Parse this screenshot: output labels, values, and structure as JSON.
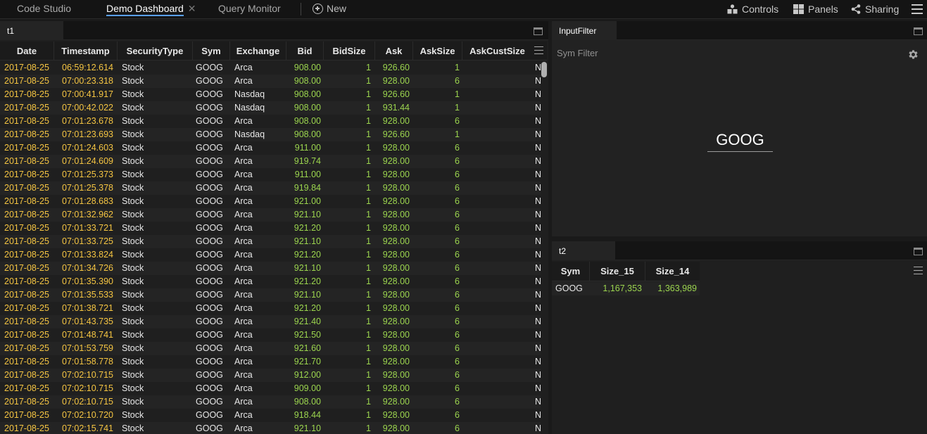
{
  "nav": {
    "tabs": [
      {
        "label": "Code Studio"
      },
      {
        "label": "Demo Dashboard",
        "active": true
      },
      {
        "label": "Query Monitor"
      }
    ],
    "new_label": "New",
    "right": {
      "controls": "Controls",
      "panels": "Panels",
      "sharing": "Sharing"
    }
  },
  "colors": {
    "date": "#f5c542",
    "number": "#9bd44e",
    "accent": "#5aa0ff"
  },
  "t1": {
    "title": "t1",
    "columns": [
      "Date",
      "Timestamp",
      "SecurityType",
      "Sym",
      "Exchange",
      "Bid",
      "BidSize",
      "Ask",
      "AskSize",
      "AskCustSize"
    ],
    "rows": [
      [
        "2017-08-25",
        "06:59:12.614",
        "Stock",
        "GOOG",
        "Arca",
        "908.00",
        "1",
        "926.60",
        "1",
        "N"
      ],
      [
        "2017-08-25",
        "07:00:23.318",
        "Stock",
        "GOOG",
        "Arca",
        "908.00",
        "1",
        "928.00",
        "6",
        "N"
      ],
      [
        "2017-08-25",
        "07:00:41.917",
        "Stock",
        "GOOG",
        "Nasdaq",
        "908.00",
        "1",
        "926.60",
        "1",
        "N"
      ],
      [
        "2017-08-25",
        "07:00:42.022",
        "Stock",
        "GOOG",
        "Nasdaq",
        "908.00",
        "1",
        "931.44",
        "1",
        "N"
      ],
      [
        "2017-08-25",
        "07:01:23.678",
        "Stock",
        "GOOG",
        "Arca",
        "908.00",
        "1",
        "928.00",
        "6",
        "N"
      ],
      [
        "2017-08-25",
        "07:01:23.693",
        "Stock",
        "GOOG",
        "Nasdaq",
        "908.00",
        "1",
        "926.60",
        "1",
        "N"
      ],
      [
        "2017-08-25",
        "07:01:24.603",
        "Stock",
        "GOOG",
        "Arca",
        "911.00",
        "1",
        "928.00",
        "6",
        "N"
      ],
      [
        "2017-08-25",
        "07:01:24.609",
        "Stock",
        "GOOG",
        "Arca",
        "919.74",
        "1",
        "928.00",
        "6",
        "N"
      ],
      [
        "2017-08-25",
        "07:01:25.373",
        "Stock",
        "GOOG",
        "Arca",
        "911.00",
        "1",
        "928.00",
        "6",
        "N"
      ],
      [
        "2017-08-25",
        "07:01:25.378",
        "Stock",
        "GOOG",
        "Arca",
        "919.84",
        "1",
        "928.00",
        "6",
        "N"
      ],
      [
        "2017-08-25",
        "07:01:28.683",
        "Stock",
        "GOOG",
        "Arca",
        "921.00",
        "1",
        "928.00",
        "6",
        "N"
      ],
      [
        "2017-08-25",
        "07:01:32.962",
        "Stock",
        "GOOG",
        "Arca",
        "921.10",
        "1",
        "928.00",
        "6",
        "N"
      ],
      [
        "2017-08-25",
        "07:01:33.721",
        "Stock",
        "GOOG",
        "Arca",
        "921.20",
        "1",
        "928.00",
        "6",
        "N"
      ],
      [
        "2017-08-25",
        "07:01:33.725",
        "Stock",
        "GOOG",
        "Arca",
        "921.10",
        "1",
        "928.00",
        "6",
        "N"
      ],
      [
        "2017-08-25",
        "07:01:33.824",
        "Stock",
        "GOOG",
        "Arca",
        "921.20",
        "1",
        "928.00",
        "6",
        "N"
      ],
      [
        "2017-08-25",
        "07:01:34.726",
        "Stock",
        "GOOG",
        "Arca",
        "921.10",
        "1",
        "928.00",
        "6",
        "N"
      ],
      [
        "2017-08-25",
        "07:01:35.390",
        "Stock",
        "GOOG",
        "Arca",
        "921.20",
        "1",
        "928.00",
        "6",
        "N"
      ],
      [
        "2017-08-25",
        "07:01:35.533",
        "Stock",
        "GOOG",
        "Arca",
        "921.10",
        "1",
        "928.00",
        "6",
        "N"
      ],
      [
        "2017-08-25",
        "07:01:38.721",
        "Stock",
        "GOOG",
        "Arca",
        "921.20",
        "1",
        "928.00",
        "6",
        "N"
      ],
      [
        "2017-08-25",
        "07:01:43.735",
        "Stock",
        "GOOG",
        "Arca",
        "921.40",
        "1",
        "928.00",
        "6",
        "N"
      ],
      [
        "2017-08-25",
        "07:01:48.741",
        "Stock",
        "GOOG",
        "Arca",
        "921.50",
        "1",
        "928.00",
        "6",
        "N"
      ],
      [
        "2017-08-25",
        "07:01:53.759",
        "Stock",
        "GOOG",
        "Arca",
        "921.60",
        "1",
        "928.00",
        "6",
        "N"
      ],
      [
        "2017-08-25",
        "07:01:58.778",
        "Stock",
        "GOOG",
        "Arca",
        "921.70",
        "1",
        "928.00",
        "6",
        "N"
      ],
      [
        "2017-08-25",
        "07:02:10.715",
        "Stock",
        "GOOG",
        "Arca",
        "912.00",
        "1",
        "928.00",
        "6",
        "N"
      ],
      [
        "2017-08-25",
        "07:02:10.715",
        "Stock",
        "GOOG",
        "Arca",
        "909.00",
        "1",
        "928.00",
        "6",
        "N"
      ],
      [
        "2017-08-25",
        "07:02:10.715",
        "Stock",
        "GOOG",
        "Arca",
        "908.00",
        "1",
        "928.00",
        "6",
        "N"
      ],
      [
        "2017-08-25",
        "07:02:10.720",
        "Stock",
        "GOOG",
        "Arca",
        "918.44",
        "1",
        "928.00",
        "6",
        "N"
      ],
      [
        "2017-08-25",
        "07:02:15.741",
        "Stock",
        "GOOG",
        "Arca",
        "921.10",
        "1",
        "928.00",
        "6",
        "N"
      ]
    ]
  },
  "input_filter": {
    "title": "InputFilter",
    "label": "Sym Filter",
    "value": "GOOG"
  },
  "t2": {
    "title": "t2",
    "columns": [
      "Sym",
      "Size_15",
      "Size_14"
    ],
    "rows": [
      [
        "GOOG",
        "1,167,353",
        "1,363,989"
      ]
    ]
  }
}
